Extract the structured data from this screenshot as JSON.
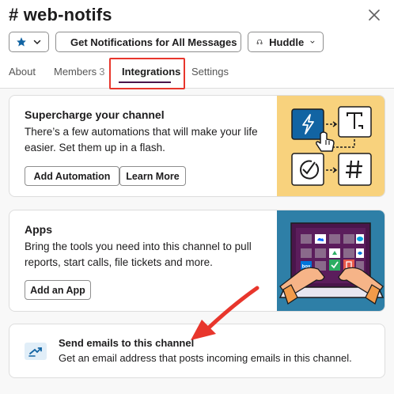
{
  "header": {
    "channel_name": "# web-notifs",
    "notification_button": "Get Notifications for All Messages",
    "huddle_button": "Huddle"
  },
  "tabs": [
    {
      "label": "About"
    },
    {
      "label": "Members",
      "count": "3"
    },
    {
      "label": "Integrations",
      "active": true
    },
    {
      "label": "Settings"
    }
  ],
  "automations": {
    "title": "Supercharge your channel",
    "description": "There’s a few automations that will make your life easier. Set them up in a flash.",
    "add_button": "Add Automation",
    "learn_button": "Learn More"
  },
  "apps": {
    "title": "Apps",
    "description": "Bring the tools you need into this channel to pull reports, start calls, file tickets and more.",
    "add_button": "Add an App",
    "tile_badge": "box"
  },
  "emails": {
    "title": "Send emails to this channel",
    "description": "Get an email address that posts incoming emails in this channel."
  },
  "colors": {
    "accent_purple": "#4a154b",
    "highlight_red": "#e8362c",
    "illustration_yellow": "#f8d27d",
    "illustration_teal": "#2e7fa7",
    "icon_blue": "#1264a3"
  },
  "icons": [
    "close-icon",
    "star-icon",
    "bell-icon",
    "headphones-icon",
    "chevron-down-icon",
    "lightning-icon",
    "text-icon",
    "checkmark-icon",
    "hash-icon",
    "cursor-hand-icon",
    "email-forward-icon",
    "arrow-annotation"
  ]
}
